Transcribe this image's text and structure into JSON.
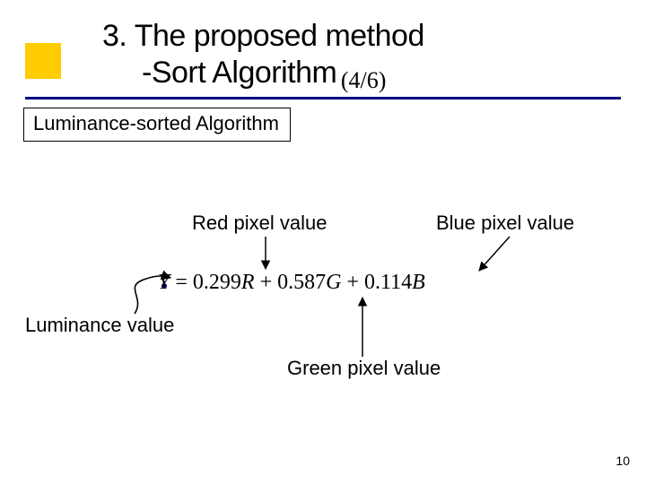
{
  "title": {
    "line1": "3. The proposed method",
    "line2_prefix": "-Sort Algorithm",
    "fraction": "(4/6)"
  },
  "subtitle": "Luminance-sorted Algorithm",
  "labels": {
    "red": "Red pixel value",
    "blue": "Blue pixel value",
    "luminance": "Luminance value",
    "green": "Green pixel value"
  },
  "formula": {
    "text": "Y = 0.299R + 0.587G + 0.114B",
    "terms": {
      "Y": "Y",
      "eq": " = ",
      "c1": "0.299",
      "R": "R",
      "p1": " + ",
      "c2": "0.587",
      "G": "G",
      "p2": " + ",
      "c3": "0.114",
      "B": "B"
    }
  },
  "page_number": "10"
}
